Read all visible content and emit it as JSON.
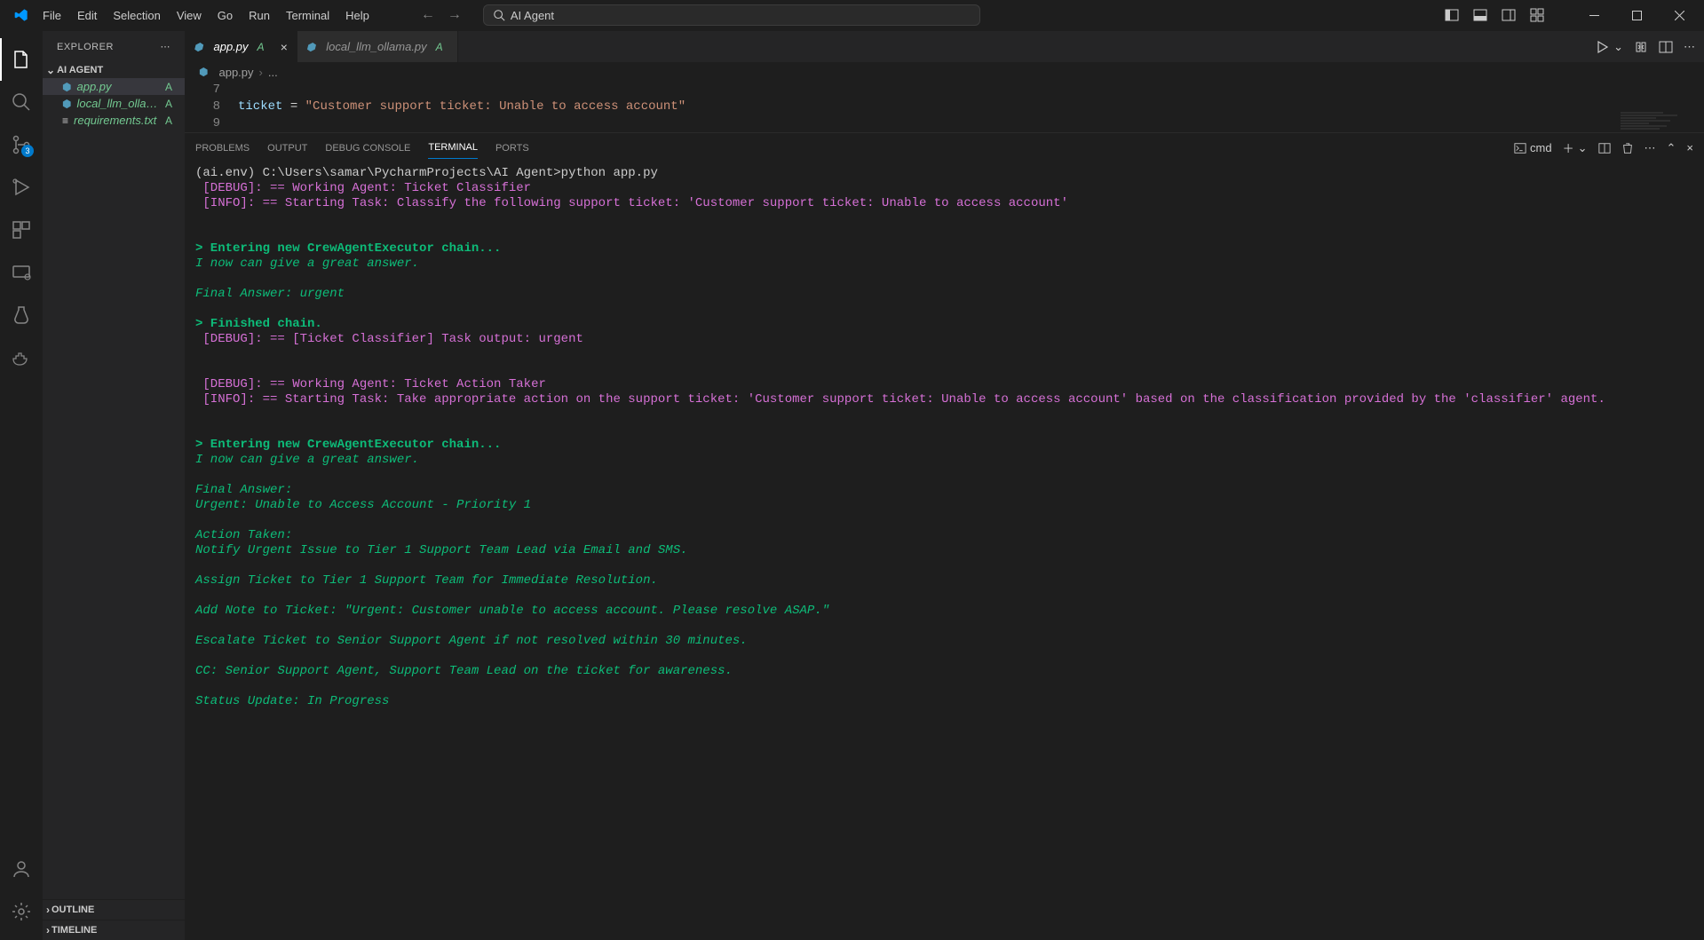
{
  "menu": [
    "File",
    "Edit",
    "Selection",
    "View",
    "Go",
    "Run",
    "Terminal",
    "Help"
  ],
  "search_text": "AI Agent",
  "activity": {
    "scm_badge": "3"
  },
  "sidebar": {
    "title": "EXPLORER",
    "project": "AI AGENT",
    "files": [
      {
        "name": "app.py",
        "badge": "A",
        "icon": "py",
        "active": true
      },
      {
        "name": "local_llm_ollama....",
        "badge": "A",
        "icon": "py",
        "active": false
      },
      {
        "name": "requirements.txt",
        "badge": "A",
        "icon": "txt",
        "active": false
      }
    ],
    "outline": "OUTLINE",
    "timeline": "TIMELINE"
  },
  "tabs": [
    {
      "name": "app.py",
      "badge": "A",
      "active": true,
      "close": true
    },
    {
      "name": "local_llm_ollama.py",
      "badge": "A",
      "active": false,
      "close": false
    }
  ],
  "breadcrumb": {
    "file": "app.py",
    "rest": "..."
  },
  "code": {
    "lines": [
      {
        "num": "7",
        "content": ""
      },
      {
        "num": "8",
        "content_var": "ticket",
        "content_op": " = ",
        "content_str": "\"Customer support ticket: Unable to access account\""
      },
      {
        "num": "9",
        "content": ""
      }
    ]
  },
  "panel": {
    "tabs": [
      "PROBLEMS",
      "OUTPUT",
      "DEBUG CONSOLE",
      "TERMINAL",
      "PORTS"
    ],
    "active_tab": "TERMINAL",
    "shell_label": "cmd"
  },
  "terminal_lines": [
    {
      "cls": "t-default",
      "text": "(ai.env) C:\\Users\\samar\\PycharmProjects\\AI Agent>python app.py"
    },
    {
      "cls": "t-magenta",
      "text": " [DEBUG]: == Working Agent: Ticket Classifier"
    },
    {
      "cls": "t-magenta",
      "text": " [INFO]: == Starting Task: Classify the following support ticket: 'Customer support ticket: Unable to access account'"
    },
    {
      "cls": "t-default",
      "text": ""
    },
    {
      "cls": "t-default",
      "text": ""
    },
    {
      "cls": "t-green-bold",
      "text": "> Entering new CrewAgentExecutor chain..."
    },
    {
      "cls": "t-green-italic",
      "text": "I now can give a great answer."
    },
    {
      "cls": "t-default",
      "text": ""
    },
    {
      "cls": "t-green-italic",
      "text": "Final Answer: urgent"
    },
    {
      "cls": "t-default",
      "text": ""
    },
    {
      "cls": "t-green-bold",
      "text": "> Finished chain."
    },
    {
      "cls": "t-magenta",
      "text": " [DEBUG]: == [Ticket Classifier] Task output: urgent"
    },
    {
      "cls": "t-default",
      "text": ""
    },
    {
      "cls": "t-default",
      "text": ""
    },
    {
      "cls": "t-magenta",
      "text": " [DEBUG]: == Working Agent: Ticket Action Taker"
    },
    {
      "cls": "t-magenta",
      "text": " [INFO]: == Starting Task: Take appropriate action on the support ticket: 'Customer support ticket: Unable to access account' based on the classification provided by the 'classifier' agent."
    },
    {
      "cls": "t-default",
      "text": ""
    },
    {
      "cls": "t-default",
      "text": ""
    },
    {
      "cls": "t-green-bold",
      "text": "> Entering new CrewAgentExecutor chain..."
    },
    {
      "cls": "t-green-italic",
      "text": "I now can give a great answer."
    },
    {
      "cls": "t-default",
      "text": ""
    },
    {
      "cls": "t-green-italic",
      "text": "Final Answer:"
    },
    {
      "cls": "t-green-italic",
      "text": "Urgent: Unable to Access Account - Priority 1"
    },
    {
      "cls": "t-default",
      "text": ""
    },
    {
      "cls": "t-green-italic",
      "text": "Action Taken:"
    },
    {
      "cls": "t-green-italic",
      "text": "Notify Urgent Issue to Tier 1 Support Team Lead via Email and SMS."
    },
    {
      "cls": "t-default",
      "text": ""
    },
    {
      "cls": "t-green-italic",
      "text": "Assign Ticket to Tier 1 Support Team for Immediate Resolution."
    },
    {
      "cls": "t-default",
      "text": ""
    },
    {
      "cls": "t-green-italic",
      "text": "Add Note to Ticket: \"Urgent: Customer unable to access account. Please resolve ASAP.\""
    },
    {
      "cls": "t-default",
      "text": ""
    },
    {
      "cls": "t-green-italic",
      "text": "Escalate Ticket to Senior Support Agent if not resolved within 30 minutes."
    },
    {
      "cls": "t-default",
      "text": ""
    },
    {
      "cls": "t-green-italic",
      "text": "CC: Senior Support Agent, Support Team Lead on the ticket for awareness."
    },
    {
      "cls": "t-default",
      "text": ""
    },
    {
      "cls": "t-green-italic",
      "text": "Status Update: In Progress"
    }
  ]
}
